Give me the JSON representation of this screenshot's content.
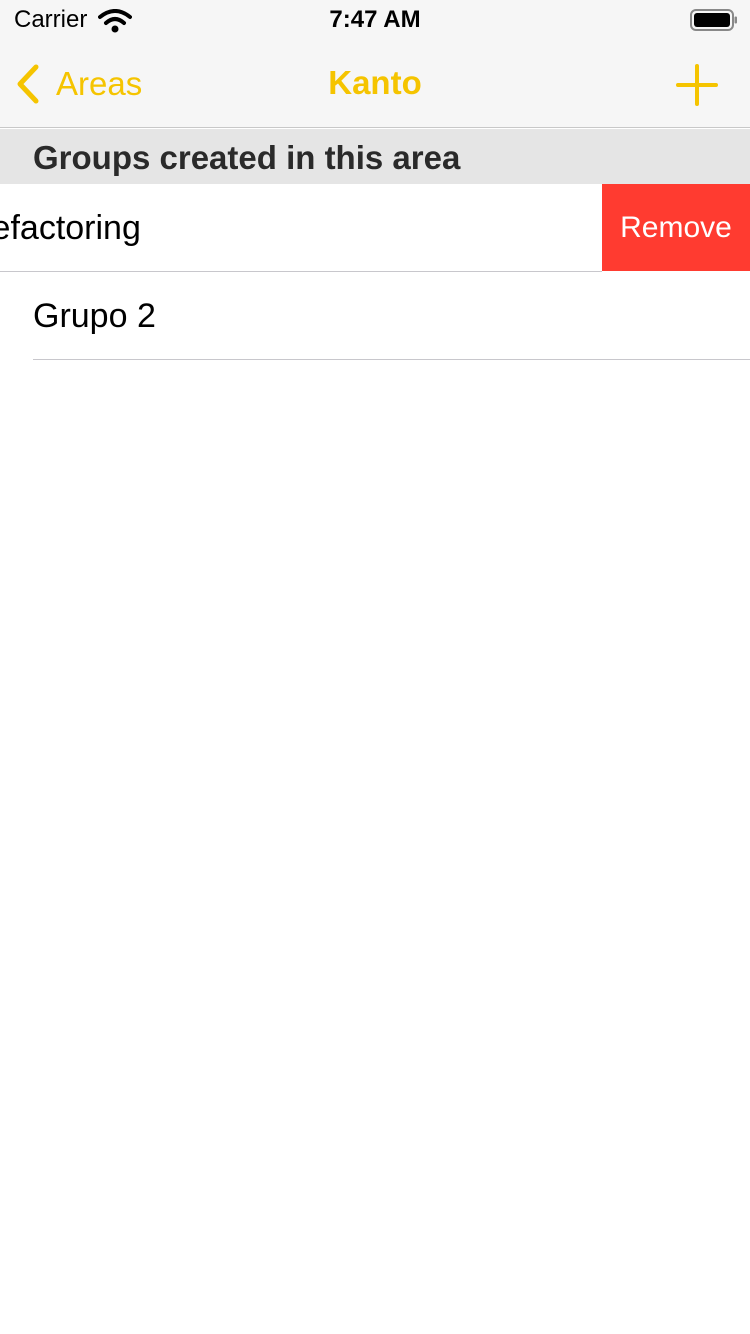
{
  "status_bar": {
    "carrier": "Carrier",
    "time": "7:47 AM",
    "icons": [
      "wifi-icon",
      "battery-icon"
    ]
  },
  "nav_bar": {
    "back_label": "Areas",
    "title": "Kanto",
    "back_icon": "chevron-left-icon",
    "add_icon": "plus-icon"
  },
  "section": {
    "header": "Groups created in this area"
  },
  "rows": [
    {
      "label": "Refactoring",
      "action_label": "Remove",
      "swiped": true
    },
    {
      "label": "Grupo 2"
    }
  ],
  "colors": {
    "accent": "#f5c400",
    "destructive": "#ff3b30",
    "bar_background": "#f6f6f6",
    "section_background": "#e5e5e5"
  }
}
